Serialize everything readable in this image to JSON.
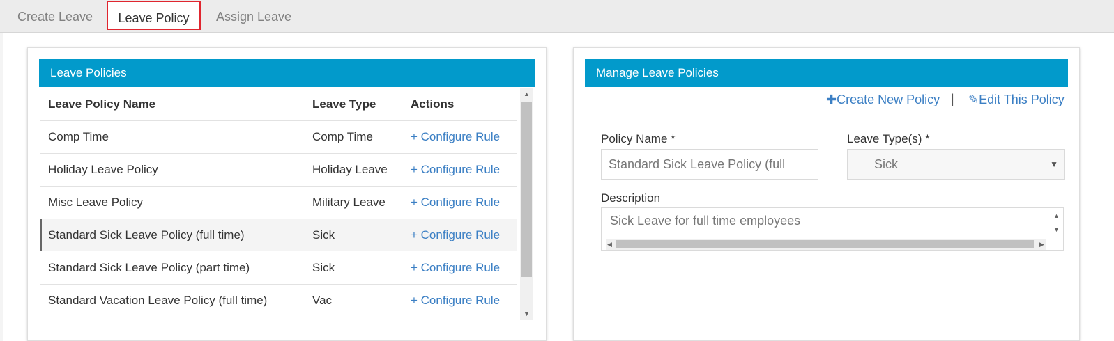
{
  "tabs": [
    {
      "label": "Create Leave"
    },
    {
      "label": "Leave Policy"
    },
    {
      "label": "Assign Leave"
    }
  ],
  "left_panel": {
    "title": "Leave Policies",
    "columns": [
      "Leave Policy Name",
      "Leave Type",
      "Actions"
    ],
    "rows": [
      {
        "name": "Comp Time",
        "type": "Comp Time",
        "action": "+ Configure Rule"
      },
      {
        "name": "Holiday Leave Policy",
        "type": "Holiday Leave",
        "action": "+ Configure Rule"
      },
      {
        "name": "Misc Leave Policy",
        "type": "Military Leave",
        "action": "+ Configure Rule"
      },
      {
        "name": "Standard Sick Leave Policy (full time)",
        "type": "Sick",
        "action": "+ Configure Rule"
      },
      {
        "name": "Standard Sick Leave Policy (part time)",
        "type": "Sick",
        "action": "+ Configure Rule"
      },
      {
        "name": "Standard Vacation Leave Policy (full time)",
        "type": "Vac",
        "action": "+ Configure Rule"
      }
    ]
  },
  "right_panel": {
    "title": "Manage Leave Policies",
    "create_link": "Create New Policy",
    "separator": "|",
    "edit_link": "Edit This Policy",
    "policy_name_label": "Policy Name *",
    "policy_name_value": "Standard Sick Leave Policy (full",
    "leave_type_label": "Leave Type(s) *",
    "leave_type_value": "Sick",
    "description_label": "Description",
    "description_value": "Sick Leave for full time employees"
  },
  "colors": {
    "header_bg": "#029acb",
    "link": "#3b7fc4",
    "active_tab_border": "#e0262f"
  }
}
